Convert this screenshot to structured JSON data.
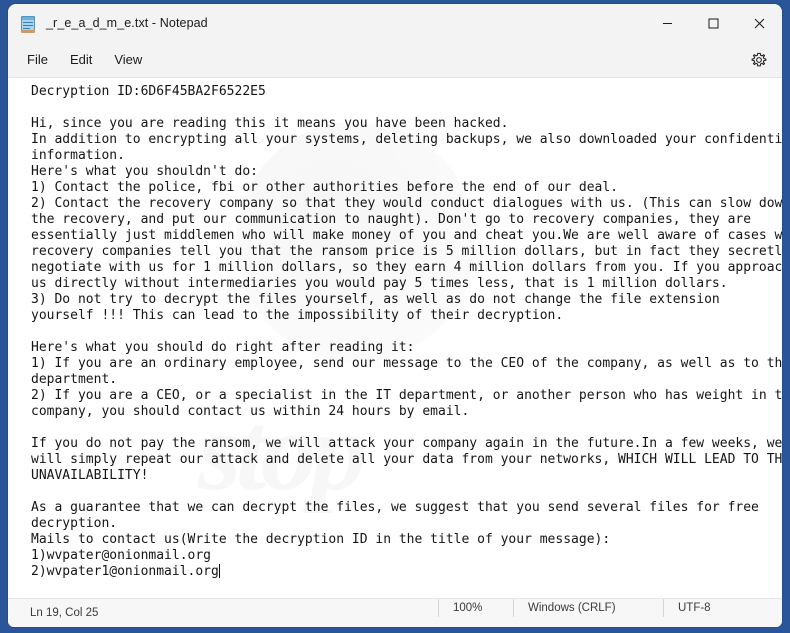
{
  "window": {
    "title": "_r_e_a_d_m_e.txt - Notepad",
    "app_icon": "notepad-icon",
    "controls": {
      "minimize": "minimize-icon",
      "maximize": "maximize-icon",
      "close": "close-icon"
    }
  },
  "menu": {
    "items": [
      {
        "label": "File"
      },
      {
        "label": "Edit"
      },
      {
        "label": "View"
      }
    ],
    "settings_icon": "gear-icon"
  },
  "editor": {
    "watermark_text": "stop",
    "caret_after_line": 19,
    "lines": [
      "Decryption ID:6D6F45BA2F6522E5",
      "",
      "Hi, since you are reading this it means you have been hacked.",
      "In addition to encrypting all your systems, deleting backups, we also downloaded your confidential",
      "information.",
      "Here's what you shouldn't do:",
      "1) Contact the police, fbi or other authorities before the end of our deal.",
      "2) Contact the recovery company so that they would conduct dialogues with us. (This can slow down",
      "the recovery, and put our communication to naught). Don't go to recovery companies, they are",
      "essentially just middlemen who will make money of you and cheat you.We are well aware of cases where",
      "recovery companies tell you that the ransom price is 5 million dollars, but in fact they secretly",
      "negotiate with us for 1 million dollars, so they earn 4 million dollars from you. If you approached",
      "us directly without intermediaries you would pay 5 times less, that is 1 million dollars.",
      "3) Do not try to decrypt the files yourself, as well as do not change the file extension",
      "yourself !!! This can lead to the impossibility of their decryption.",
      "",
      "Here's what you should do right after reading it:",
      "1) If you are an ordinary employee, send our message to the CEO of the company, as well as to the IT",
      "department.",
      "2) If you are a CEO, or a specialist in the IT department, or another person who has weight in the",
      "company, you should contact us within 24 hours by email.",
      "",
      "If you do not pay the ransom, we will attack your company again in the future.In a few weeks, we",
      "will simply repeat our attack and delete all your data from your networks, WHICH WILL LEAD TO THEIR",
      "UNAVAILABILITY!",
      "",
      "As a guarantee that we can decrypt the files, we suggest that you send several files for free",
      "decryption.",
      "Mails to contact us(Write the decryption ID in the title of your message):",
      "1)wvpater@onionmail.org",
      "2)wvpater1@onionmail.org"
    ]
  },
  "statusbar": {
    "line_col": "Ln 19, Col 25",
    "zoom": "100%",
    "line_endings": "Windows (CRLF)",
    "encoding": "UTF-8"
  },
  "colors": {
    "desktop_blue": "#2a5699",
    "chrome": "#f3f3f3",
    "editor_bg": "#ffffff",
    "text": "#151515",
    "close_hover": "#c42b1c"
  }
}
